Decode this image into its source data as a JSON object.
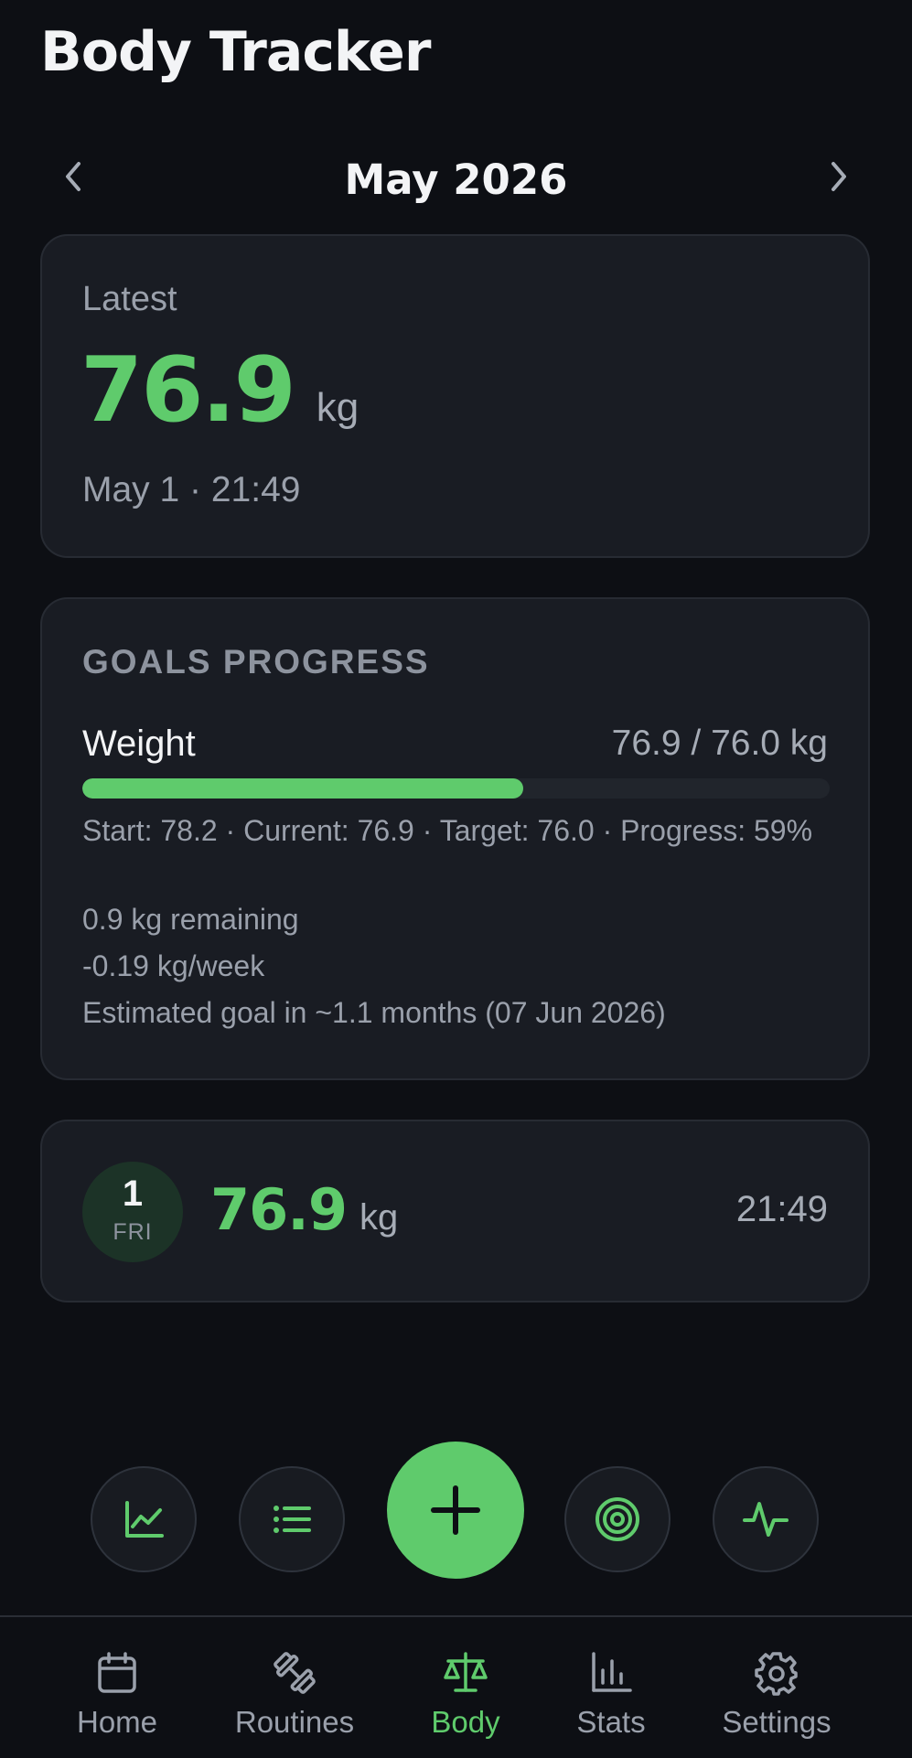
{
  "app": {
    "title": "Body Tracker"
  },
  "month_nav": {
    "label": "May 2026"
  },
  "latest": {
    "label": "Latest",
    "value": "76.9",
    "unit": "kg",
    "date": "May 1 · 21:49"
  },
  "goals": {
    "heading": "GOALS PROGRESS",
    "name": "Weight",
    "ratio": "76.9 / 76.0 kg",
    "progress_fraction": 0.59,
    "details": "Start: 78.2 · Current: 76.9 · Target: 76.0 · Progress: 59%",
    "remaining": "0.9 kg remaining",
    "rate": "-0.19 kg/week",
    "estimate": "Estimated goal in ~1.1 months (07 Jun 2026)"
  },
  "entry": {
    "day_number": "1",
    "day_name": "FRI",
    "value": "76.9",
    "unit": "kg",
    "time": "21:49"
  },
  "quick_actions": [
    "chart-icon",
    "list-icon",
    "add-icon",
    "target-icon",
    "activity-icon"
  ],
  "bottom_nav": {
    "items": [
      {
        "label": "Home",
        "icon": "calendar-icon"
      },
      {
        "label": "Routines",
        "icon": "dumbbell-icon"
      },
      {
        "label": "Body",
        "icon": "scale-icon",
        "active": true
      },
      {
        "label": "Stats",
        "icon": "bar-chart-icon"
      },
      {
        "label": "Settings",
        "icon": "gear-icon"
      }
    ]
  },
  "colors": {
    "accent": "#5fcb6c",
    "background": "#0d0f14",
    "card": "#191c23"
  }
}
